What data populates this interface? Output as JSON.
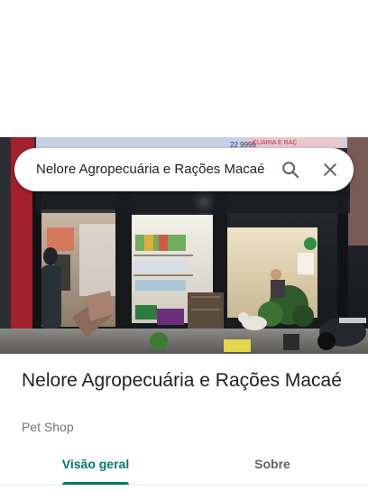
{
  "search": {
    "query": "Nelore Agropecuária e Rações Macaé",
    "search_icon": "search-icon",
    "close_icon": "close-icon"
  },
  "photo": {
    "description_icon": "storefront-photo",
    "sign_fragment_1": "CUÁRIA E RAÇ",
    "sign_fragment_2": "22 9996"
  },
  "place": {
    "name": "Nelore Agropecuária e Rações Macaé",
    "category": "Pet Shop"
  },
  "tabs": [
    {
      "label": "Visão geral",
      "active": true
    },
    {
      "label": "Sobre",
      "active": false
    }
  ],
  "colors": {
    "accent": "#00796b",
    "text_primary": "#202124",
    "text_secondary": "#70757a"
  }
}
